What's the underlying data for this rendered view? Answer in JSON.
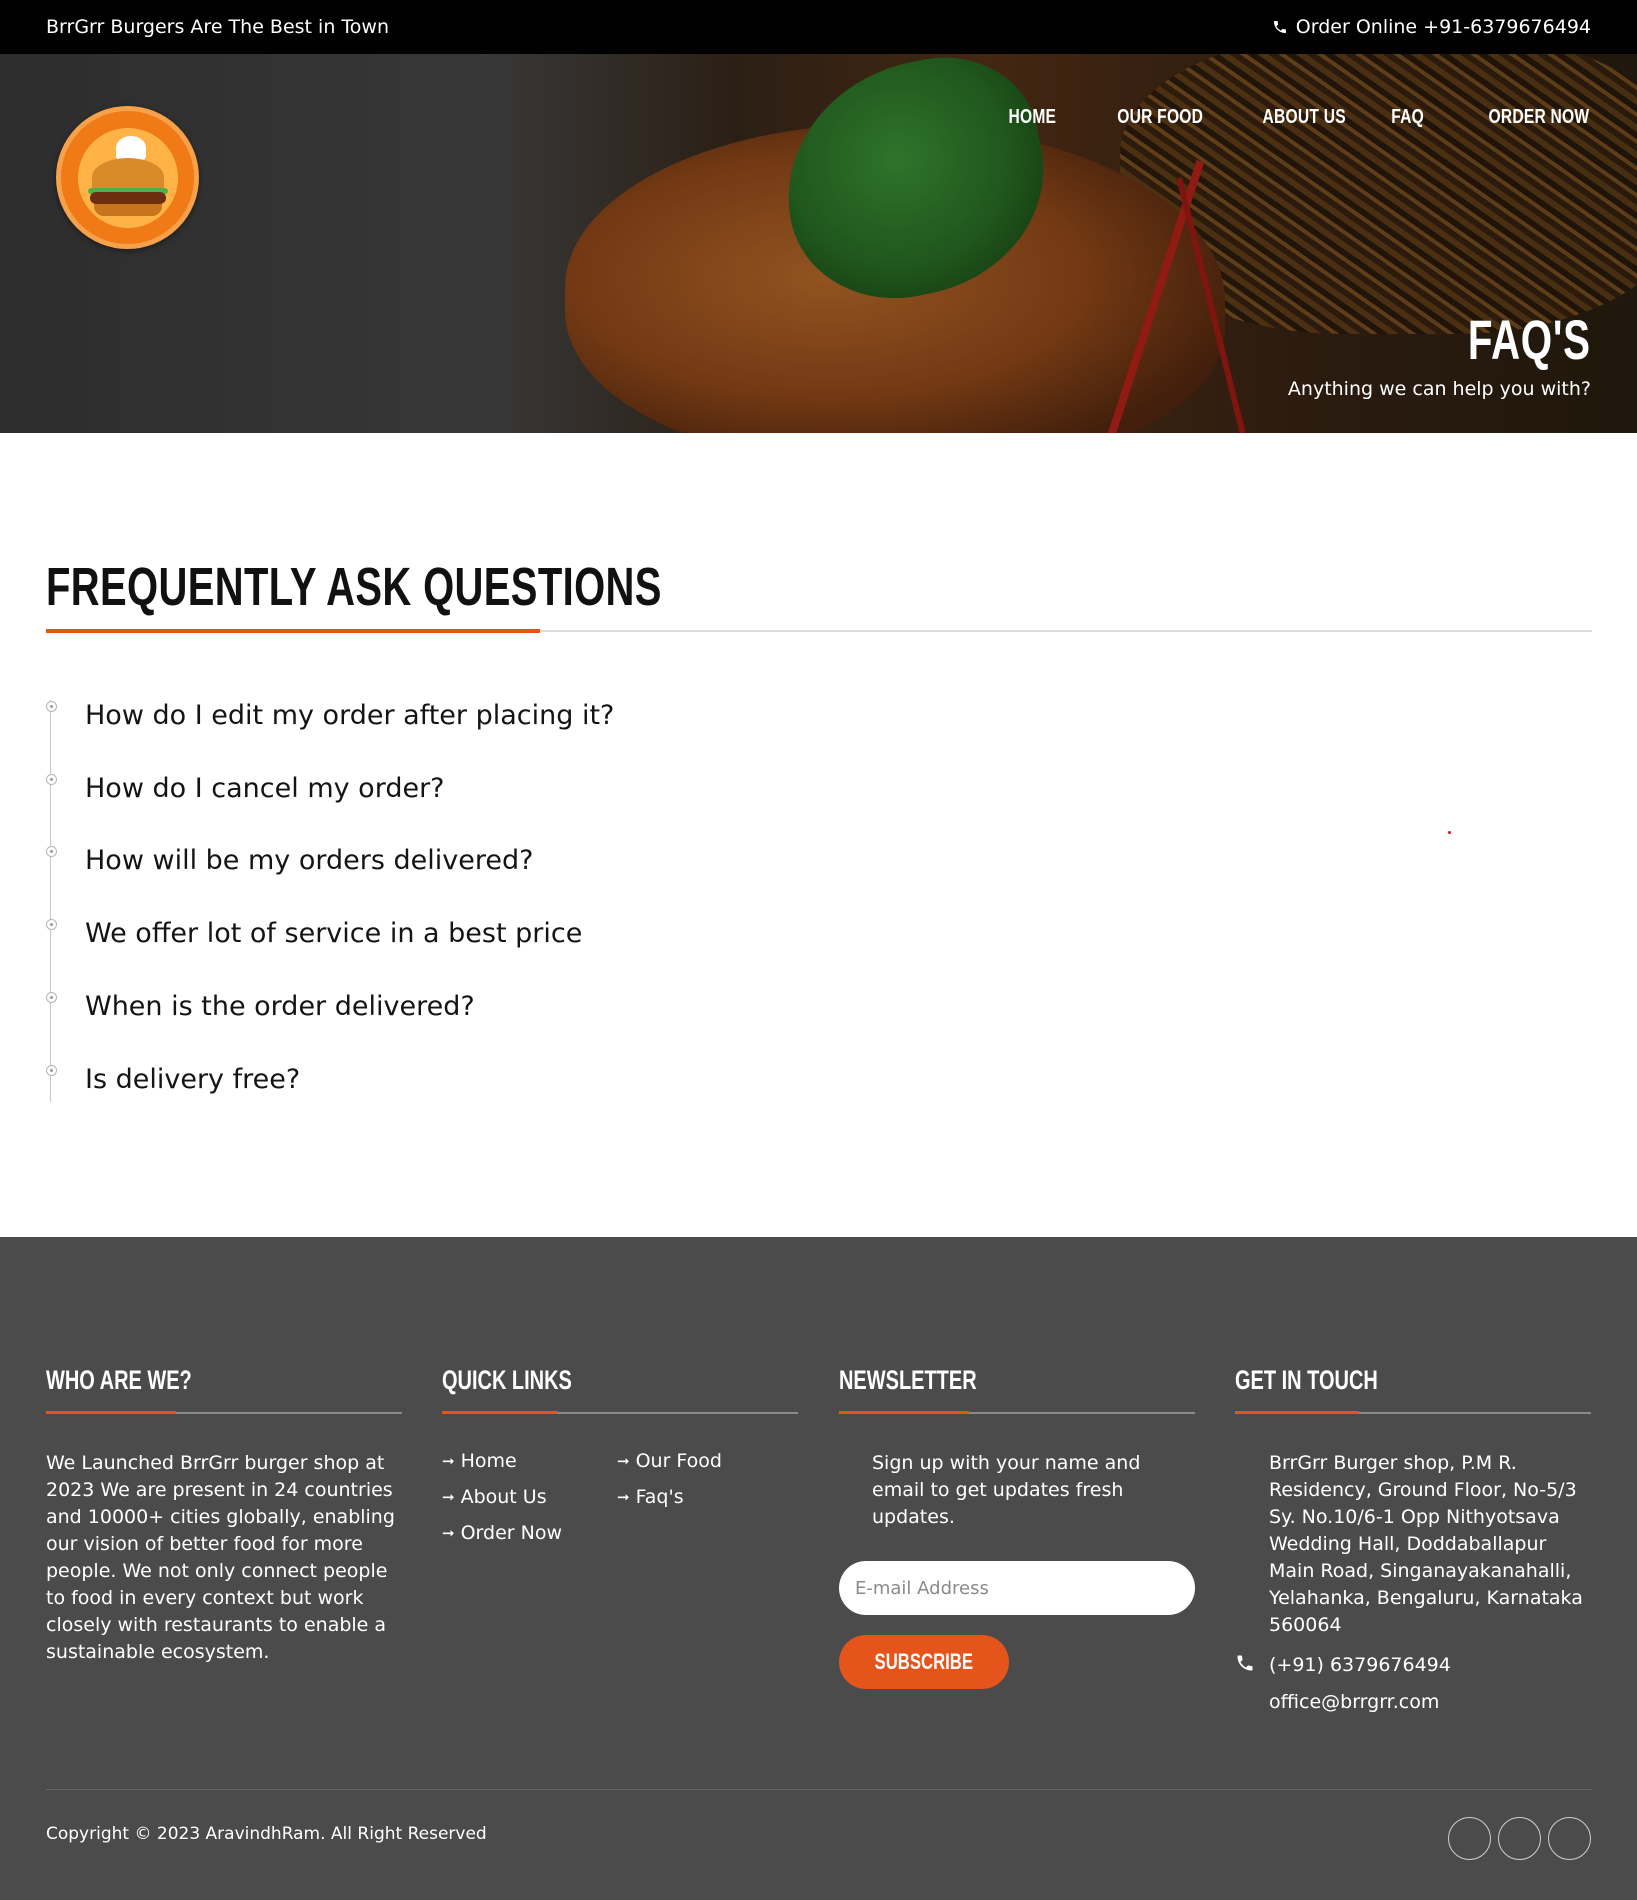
{
  "topbar": {
    "tagline": "BrrGrr Burgers Are The Best in Town",
    "order_text": "Order Online +91-6379676494"
  },
  "nav": {
    "items": [
      "HOME",
      "OUR FOOD",
      "ABOUT US",
      "FAQ",
      "ORDER NOW"
    ]
  },
  "hero": {
    "title": "FAQ'S",
    "subtitle": "Anything we can help you with?"
  },
  "faq": {
    "heading": "FREQUENTLY ASK QUESTIONS",
    "questions": [
      "How do I edit my order after placing it?",
      "How do I cancel my order?",
      "How will be my orders delivered?",
      "We offer lot of service in a best price",
      "When is the order delivered?",
      "Is delivery free?"
    ]
  },
  "footer": {
    "about": {
      "heading": "WHO ARE WE?",
      "text": "We Launched BrrGrr burger shop at 2023 We are present in 24 countries and 10000+ cities globally, enabling our vision of better food for more people. We not only connect people to food in every context but work closely with restaurants to enable a sustainable ecosystem."
    },
    "quick_links": {
      "heading": "QUICK LINKS",
      "items": [
        "Home",
        "Our Food",
        "About Us",
        "Faq's",
        "Order Now"
      ]
    },
    "newsletter": {
      "heading": "NEWSLETTER",
      "text": "Sign up with your name and email to get updates fresh updates.",
      "placeholder": "E-mail Address",
      "button": "SUBSCRIBE"
    },
    "contact": {
      "heading": "GET IN TOUCH",
      "address": "BrrGrr Burger shop, P.M R. Residency, Ground Floor, No-5/3 Sy. No.10/6-1 Opp Nithyotsava Wedding Hall, Doddaballapur Main Road, Singanayakanahalli, Yelahanka, Bengaluru, Karnataka 560064",
      "phone": "(+91) 6379676494",
      "email": "office@brrgrr.com"
    },
    "copyright": "Copyright © 2023 AravindhRam. All Right Reserved"
  },
  "colors": {
    "accent": "#e4541b",
    "footer_bg": "#4b4b4b",
    "topbar_bg": "#000000"
  },
  "icons": [
    "phone-icon",
    "logo",
    "arrow-right-icon",
    "social-icon"
  ]
}
